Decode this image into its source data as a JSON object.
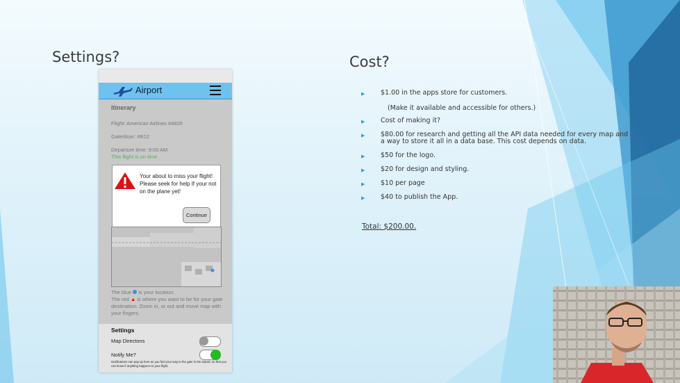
{
  "slide": {
    "settings_heading": "Settings?",
    "cost_heading": "Cost?"
  },
  "phone": {
    "app_title": "Airport",
    "itinerary_title": "Itinerary",
    "flight": "Flight:  American Airlines #4826",
    "gate": "Gate/door:   #B12",
    "departure": "Departure time:  9:00 AM",
    "status": "This flight is on time",
    "alert_message": "Your about to miss your flight!  Please seek for help If your not  on the plane yet!",
    "continue_label": "Continue",
    "legend_line1": "The blue",
    "legend_line1b": "is your location.",
    "legend_line2": "The red",
    "legend_line2b": "is where you want to be for your gate destination.  Zoom in, or out and move map with your fingers.",
    "settings_title": "Settings",
    "map_directions_label": "Map Directons",
    "notify_label": "Notify Me?",
    "notify_note": "Notifications can pop up here as you find your way to the gate in the airport, so that you can know if anything happens to your flight.",
    "map_directions_on": false,
    "notify_on": true,
    "colors": {
      "appbar": "#6ec2f0",
      "toggle_on": "#22bb22",
      "alert_red": "#dd1111"
    }
  },
  "cost": {
    "items": [
      "$1.00 in the apps store for customers.",
      "Cost of making it?",
      "$80.00 for research and getting all the API data needed for every map and a way to store it all in a data base.  This cost depends on data.",
      "$50 for the logo.",
      "$20 for design and styling.",
      "$10 per page",
      "$40 to publish the App."
    ],
    "sub_note": "(Make it available and accessible for others.)",
    "total": "Total:  $200.00."
  }
}
